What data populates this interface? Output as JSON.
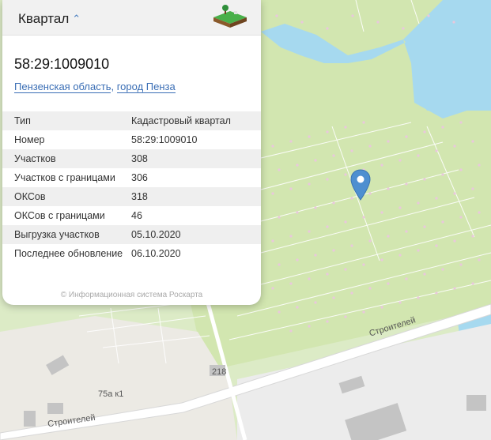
{
  "panel": {
    "title": "Квартал",
    "cadastral_number": "58:29:1009010",
    "region": "Пензенская область",
    "separator": ",",
    "city": "город Пенза",
    "rows": [
      {
        "key": "Тип",
        "value": "Кадастровый квартал"
      },
      {
        "key": "Номер",
        "value": "58:29:1009010"
      },
      {
        "key": "Участков",
        "value": "308"
      },
      {
        "key": "Участков с границами",
        "value": "306"
      },
      {
        "key": "ОКСов",
        "value": "318"
      },
      {
        "key": "ОКСов с границами",
        "value": "46"
      },
      {
        "key": "Выгрузка участков",
        "value": "05.10.2020"
      },
      {
        "key": "Последнее обновление",
        "value": "06.10.2020"
      }
    ],
    "copyright": "© Информационная система Роскарта",
    "logo_icon": "land-plot-logo-icon"
  },
  "map": {
    "street_label_1": "Строителей",
    "street_label_2": "Строителей",
    "building_label_1": "218",
    "building_label_2": "75а к1",
    "marker_icon": "location-pin-icon",
    "colors": {
      "water": "#a6d9ef",
      "forest": "#d2e6b0",
      "road": "#ffffff",
      "built": "#ececec",
      "building": "#bfbfbf",
      "marker": "#4e8fd0"
    }
  }
}
